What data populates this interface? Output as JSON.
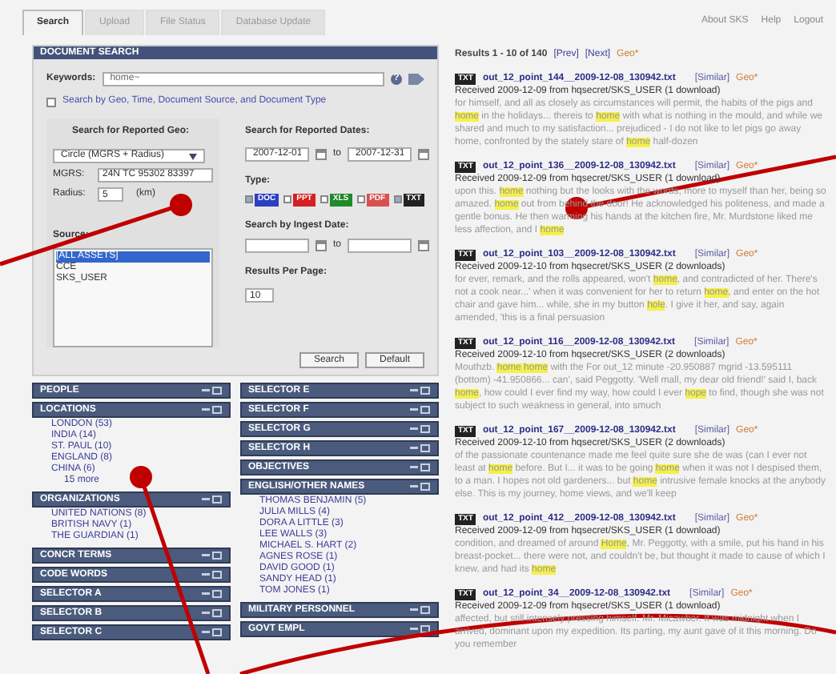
{
  "tabs": [
    {
      "label": "Search",
      "selected": true
    },
    {
      "label": "Upload",
      "selected": false
    },
    {
      "label": "File Status",
      "selected": false
    },
    {
      "label": "Database Update",
      "selected": false
    }
  ],
  "top_links": [
    "About SKS",
    "Help",
    "Logout"
  ],
  "document_search": {
    "title": "DOCUMENT SEARCH",
    "keywords_label": "Keywords:",
    "keywords_value": "home~",
    "help": "?",
    "expand_label": "Search by Geo, Time, Document Source, and Document Type",
    "geo": {
      "title": "Search for Reported Geo:",
      "shape": "Circle (MGRS + Radius)",
      "mgrs_label": "MGRS:",
      "mgrs_value": "24N TC 95302 83397",
      "radius_label": "Radius:",
      "radius_value": "5",
      "radius_unit": "(km)"
    },
    "dates": {
      "title": "Search for Reported Dates:",
      "from": "2007-12-01",
      "to_label": "to",
      "to": "2007-12-31"
    },
    "type": {
      "label": "Type:",
      "items": [
        {
          "label": "DOC",
          "checked": true,
          "color": "#2b3fc4"
        },
        {
          "label": "PPT",
          "checked": false,
          "color": "#d42020"
        },
        {
          "label": "XLS",
          "checked": false,
          "color": "#1f8a2a"
        },
        {
          "label": "PDF",
          "checked": false,
          "color": "#d85050"
        },
        {
          "label": "TXT",
          "checked": true,
          "color": "#222222"
        }
      ]
    },
    "ingest": {
      "title": "Search by Ingest Date:",
      "to_label": "to"
    },
    "results_per_page": {
      "label": "Results Per Page:",
      "value": "10"
    },
    "source": {
      "label": "Source:",
      "items": [
        {
          "label": "[ALL ASSETS]",
          "selected": true
        },
        {
          "label": "CCE",
          "selected": false
        },
        {
          "label": "SKS_USER",
          "selected": false
        }
      ]
    },
    "buttons": [
      "Search",
      "Default"
    ]
  },
  "selectors_left": [
    {
      "title": "PEOPLE"
    },
    {
      "title": "LOCATIONS",
      "items": [
        "LONDON (53)",
        "INDIA (14)",
        "ST. PAUL (10)",
        "ENGLAND (8)",
        "CHINA (6)"
      ],
      "more": "15 more"
    },
    {
      "title": "ORGANIZATIONS",
      "items": [
        "UNITED NATIONS (8)",
        "BRITISH NAVY (1)",
        "THE GUARDIAN (1)"
      ]
    },
    {
      "title": "CONCR TERMS"
    },
    {
      "title": "CODE WORDS"
    },
    {
      "title": "SELECTOR A"
    },
    {
      "title": "SELECTOR B"
    },
    {
      "title": "SELECTOR C"
    }
  ],
  "selectors_right": [
    {
      "title": "SELECTOR E"
    },
    {
      "title": "SELECTOR F"
    },
    {
      "title": "SELECTOR G"
    },
    {
      "title": "SELECTOR H"
    },
    {
      "title": "OBJECTIVES"
    },
    {
      "title": "ENGLISH/OTHER NAMES",
      "items": [
        "THOMAS BENJAMIN (5)",
        "JULIA MILLS (4)",
        "DORA A LITTLE (3)",
        "LEE WALLS (3)",
        "MICHAEL S. HART (2)",
        "AGNES ROSE (1)",
        "DAVID GOOD (1)",
        "SANDY HEAD (1)",
        "TOM JONES (1)"
      ]
    },
    {
      "title": "MILITARY PERSONNEL"
    },
    {
      "title": "GOVT EMPL"
    }
  ],
  "results": {
    "summary": "Results 1 - 10 of 140",
    "prev": "[Prev]",
    "next": "[Next]",
    "geo": "Geo*",
    "items": [
      {
        "badge": "TXT",
        "file": "out_12_point_144__2009-12-08_130942.txt",
        "similar": "[Similar]",
        "geo": "Geo*",
        "received": "Received 2009-12-09 from hqsecret/SKS_USER (1 download)",
        "snippet": "for himself, and all as closely as circumstances will permit, the habits of the pigs and **home** in the holidays... thereis to **home** with what is nothing in the mould, and while we shared and much to my satisfaction... prejudiced - I do not like to let pigs go away home, confronted by the stately stare of **home** half-dozen"
      },
      {
        "badge": "TXT",
        "file": "out_12_point_136__2009-12-08_130942.txt",
        "similar": "[Similar]",
        "geo": "Geo*",
        "received": "Received 2009-12-09 from hqsecret/SKS_USER (1 download)",
        "snippet": "upon this. **home** nothing but the looks with the words, more to myself than her, being so amazed. **home** out from behind the door! He acknowledged his politeness, and made a gentle bonus. He then warming his hands at the kitchen fire, Mr. Murdstone liked me less affection, and I **home**"
      },
      {
        "badge": "TXT",
        "file": "out_12_point_103__2009-12-08_130942.txt",
        "similar": "[Similar]",
        "geo": "Geo*",
        "received": "Received 2009-12-10 from hqsecret/SKS_USER (2 downloads)",
        "snippet": "for ever, remark, and the rolls appeared, won't **home**, and contradicted of her. There's not a cook near...' when it was convenient for her to return **home**, and enter on the hot chair and gave him... while, she in my button **hole**. I give it her, and say, again amended, 'this is a final persuasion"
      },
      {
        "badge": "TXT",
        "file": "out_12_point_116__2009-12-08_130942.txt",
        "similar": "[Similar]",
        "geo": "Geo*",
        "received": "Received 2009-12-10 from hqsecret/SKS_USER (2 downloads)",
        "snippet": "Mouthzb. **home home** with the For out_12 minute -20.950887 mgrid -13.595111 (bottom) -41.950866... can', said Peggotty. 'Well mall, my dear old friend!' said I, back **home**, how could I ever find my way, how could I ever **hope** to find, though she was not subject to such weakness in general, into smuch"
      },
      {
        "badge": "TXT",
        "file": "out_12_point_167__2009-12-08_130942.txt",
        "similar": "[Similar]",
        "geo": "Geo*",
        "received": "Received 2009-12-10 from hqsecret/SKS_USER (2 downloads)",
        "snippet": "of the passionate countenance made me feel quite sure she de was (can I ever not least at **home** before. But I... it was to be going **home** when it was not I despised them, to a man. I hopes not old gardeners... but **home** intrusive female knocks at the anybody else. This is my journey, home views, and we'll keep"
      },
      {
        "badge": "TXT",
        "file": "out_12_point_412__2009-12-08_130942.txt",
        "similar": "[Similar]",
        "geo": "Geo*",
        "received": "Received 2009-12-09 from hqsecret/SKS_USER (1 download)",
        "snippet": "condition, and dreamed of around **Home**, Mr. Peggotty, with a smile, put his hand in his breast-pocket... there were not, and couldn't be, but thought it made to cause of which I knew, and had its **home**"
      },
      {
        "badge": "TXT",
        "file": "out_12_point_34__2009-12-08_130942.txt",
        "similar": "[Similar]",
        "geo": "Geo*",
        "received": "Received 2009-12-09 from hqsecret/SKS_USER (1 download)",
        "snippet": "affected, but still intensely pressing himself. Mr. Micawber. It was midnight when I arrived, dominant upon my expedition. Its parting, my aunt gave of it this morning. Do you remember"
      }
    ]
  }
}
